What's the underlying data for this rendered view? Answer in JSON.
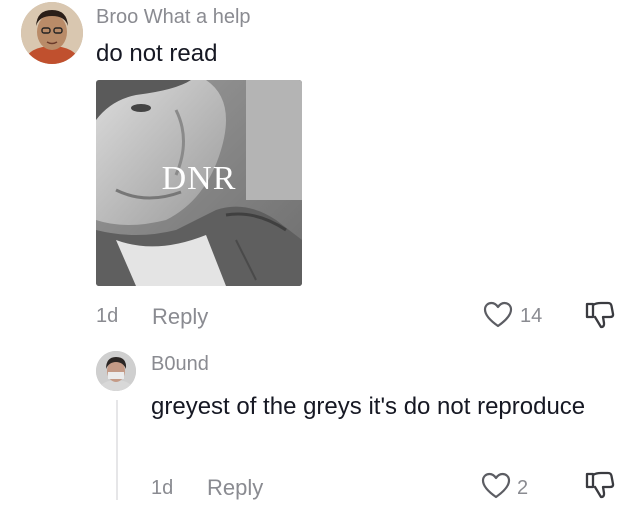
{
  "main_comment": {
    "username": "Broo What a help",
    "text": "do not read",
    "image_caption": "DNR",
    "timestamp": "1d",
    "reply_label": "Reply",
    "like_count": "14"
  },
  "reply_comment": {
    "username": "B0und",
    "text": "greyest of the greys it's do not reproduce",
    "timestamp": "1d",
    "reply_label": "Reply",
    "like_count": "2"
  },
  "icons": {
    "like": "heart-outline-icon",
    "dislike": "thumbs-down-icon"
  },
  "colors": {
    "text_primary": "#161823",
    "text_secondary": "#8a8b91"
  }
}
